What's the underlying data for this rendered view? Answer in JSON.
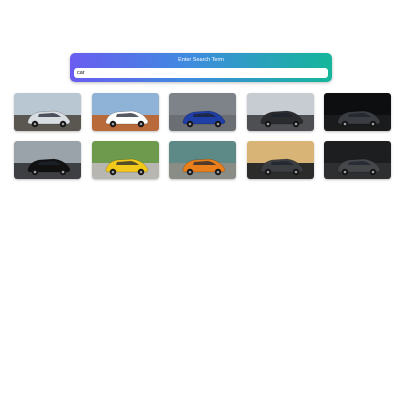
{
  "search": {
    "title": "Enter Search Term",
    "value": "car"
  },
  "gallery": {
    "images": [
      {
        "name": "car-on-road-image",
        "sky": "#b9c7d2",
        "ground": "#5a5650",
        "car": "#d8dde2"
      },
      {
        "name": "white-suv-desert-image",
        "sky": "#8fb3d6",
        "ground": "#b86a3a",
        "car": "#ffffff"
      },
      {
        "name": "blue-sports-car-image",
        "sky": "#7d8389",
        "ground": "#6b6e72",
        "car": "#1f3fa6"
      },
      {
        "name": "black-mustang-image",
        "sky": "#c7ccd2",
        "ground": "#4d4f52",
        "car": "#2a2b2e"
      },
      {
        "name": "car-headlight-dark-image",
        "sky": "#0d0e10",
        "ground": "#1a1b1d",
        "car": "#3a3d42"
      },
      {
        "name": "black-car-on-road-image",
        "sky": "#9aa2aa",
        "ground": "#3e3f42",
        "car": "#111111"
      },
      {
        "name": "yellow-sports-car-image",
        "sky": "#6e9a4e",
        "ground": "#b7b6b1",
        "car": "#f2c91a"
      },
      {
        "name": "orange-beetle-image",
        "sky": "#5d8a86",
        "ground": "#8a8c86",
        "car": "#e87f1c"
      },
      {
        "name": "car-at-sunset-image",
        "sky": "#d8b477",
        "ground": "#2c2d2b",
        "car": "#3c3e42"
      },
      {
        "name": "car-in-garage-image",
        "sky": "#1d1e20",
        "ground": "#2e2f31",
        "car": "#45474b"
      }
    ]
  }
}
